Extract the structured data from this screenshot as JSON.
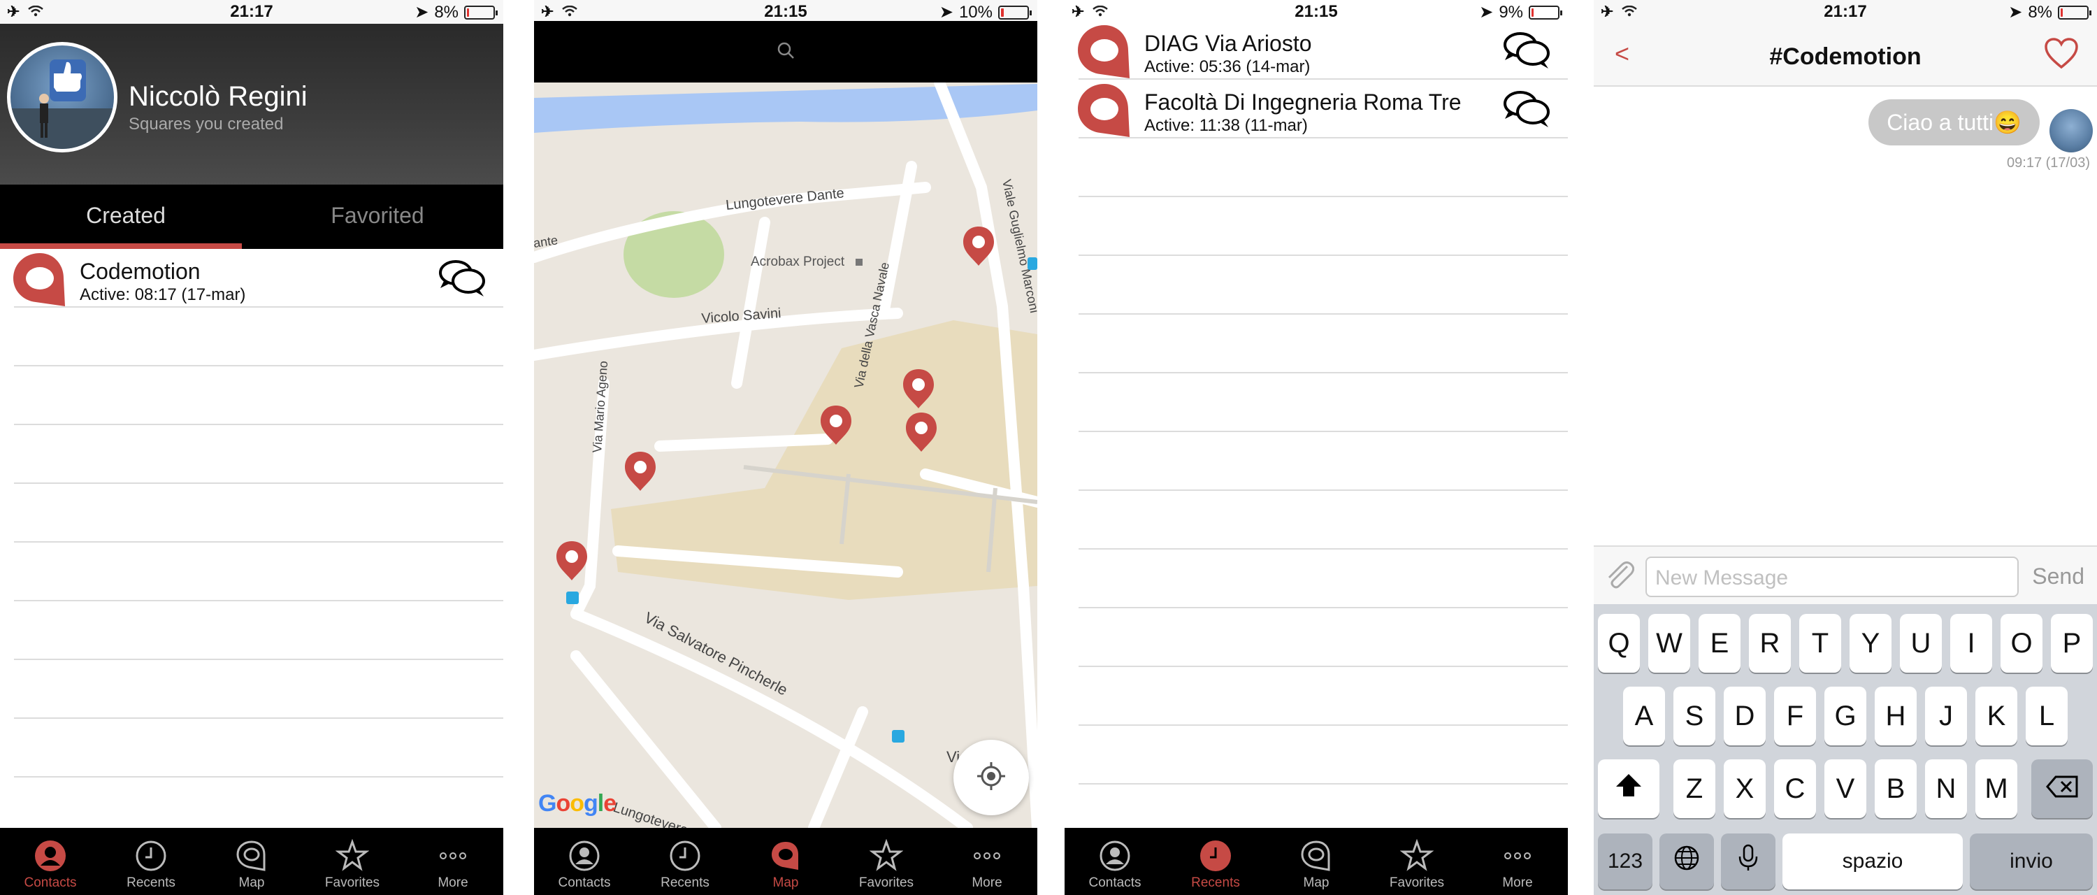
{
  "screen1": {
    "status": {
      "time": "21:17",
      "battery": "8%",
      "battery_level": 0.08
    },
    "profile": {
      "name": "Niccolò Regini",
      "subtitle": "Squares you created"
    },
    "segments": [
      {
        "label": "Created",
        "selected": true
      },
      {
        "label": "Favorited",
        "selected": false
      }
    ],
    "rows": [
      {
        "title": "Codemotion",
        "active": "Active: 08:17 (17-mar)"
      }
    ],
    "active_tab": "Contacts"
  },
  "screen2": {
    "status": {
      "time": "21:15",
      "battery": "10%",
      "battery_level": 0.1
    },
    "map": {
      "labels": {
        "lungotevere_dante": "Lungotevere Dante",
        "acrobax": "Acrobax Project",
        "vicolo_savini": "Vicolo Savini",
        "via_mario_ageno": "Via Mario Ageno",
        "via_vasca_navale": "Via della Vasca Navale",
        "viale_guglielmo": "Viale Guglielmo Marconi",
        "via_pincherle": "Via Salvatore Pincherle",
        "lungotevere_partial": "Lungotevere",
        "via_partial": "Vi",
        "ante_partial": "ante"
      },
      "google": [
        "G",
        "o",
        "o",
        "g",
        "l",
        "e"
      ],
      "google_colors": [
        "#4285f4",
        "#ea4335",
        "#fbbc05",
        "#4285f4",
        "#34a853",
        "#ea4335"
      ]
    },
    "active_tab": "Map"
  },
  "screen3": {
    "status": {
      "time": "21:15",
      "battery": "9%",
      "battery_level": 0.09
    },
    "rows": [
      {
        "title": "DIAG Via Ariosto",
        "active": "Active: 05:36 (14-mar)"
      },
      {
        "title": "Facoltà Di Ingegneria Roma Tre",
        "active": "Active: 11:38 (11-mar)"
      }
    ],
    "active_tab": "Recents"
  },
  "screen4": {
    "status": {
      "time": "21:17",
      "battery": "8%",
      "battery_level": 0.08
    },
    "nav": {
      "back": "<",
      "title": "#Codemotion"
    },
    "message": {
      "text": "Ciao a tutti😄",
      "time": "09:17 (17/03)"
    },
    "composer": {
      "placeholder": "New Message",
      "send": "Send"
    },
    "keyboard": {
      "row1": [
        "Q",
        "W",
        "E",
        "R",
        "T",
        "Y",
        "U",
        "I",
        "O",
        "P"
      ],
      "row2": [
        "A",
        "S",
        "D",
        "F",
        "G",
        "H",
        "J",
        "K",
        "L"
      ],
      "row3": [
        "Z",
        "X",
        "C",
        "V",
        "B",
        "N",
        "M"
      ],
      "numbers": "123",
      "space": "spazio",
      "return": "invio"
    }
  },
  "tabs": [
    "Contacts",
    "Recents",
    "Map",
    "Favorites",
    "More"
  ],
  "colors": {
    "accent": "#c64a45",
    "tabbar": "#000000",
    "battery_low": "#e0322f"
  }
}
